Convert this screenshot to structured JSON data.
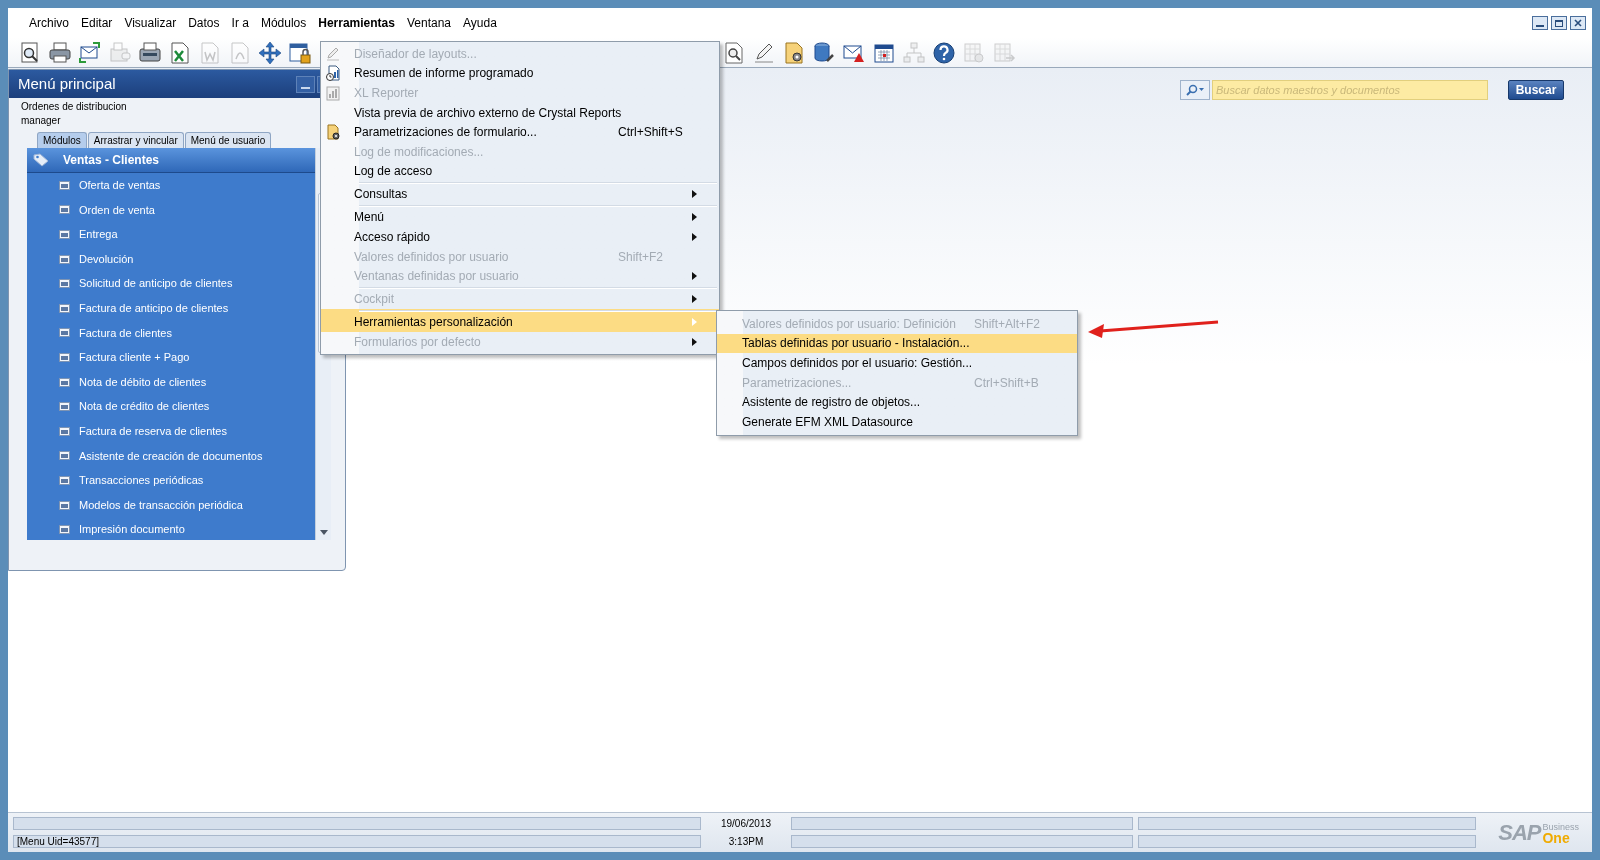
{
  "menubar": [
    {
      "label": "Archivo",
      "selected": false
    },
    {
      "label": "Editar",
      "selected": false
    },
    {
      "label": "Visualizar",
      "selected": false
    },
    {
      "label": "Datos",
      "selected": false
    },
    {
      "label": "Ir a",
      "selected": false
    },
    {
      "label": "Módulos",
      "selected": false
    },
    {
      "label": "Herramientas",
      "selected": true
    },
    {
      "label": "Ventana",
      "selected": false
    },
    {
      "label": "Ayuda",
      "selected": false
    }
  ],
  "toolbar": {
    "left": [
      {
        "disabled": false
      },
      {
        "disabled": false
      },
      {
        "disabled": false
      },
      {
        "disabled": true
      },
      {
        "disabled": false
      },
      {
        "disabled": false
      },
      {
        "disabled": true
      },
      {
        "disabled": true
      },
      {
        "disabled": false
      },
      {
        "disabled": false
      }
    ],
    "right": [
      {
        "disabled": false
      },
      {
        "disabled": false
      },
      {
        "disabled": false
      },
      {
        "disabled": false
      },
      {
        "disabled": false
      },
      {
        "disabled": false
      },
      {
        "disabled": true
      },
      {
        "disabled": false
      },
      {
        "disabled": true
      },
      {
        "disabled": true
      }
    ]
  },
  "search": {
    "placeholder": "Buscar datos maestros y documentos",
    "button": "Buscar"
  },
  "main_menu": {
    "title": "Menú principal",
    "company": "Ordenes de distribucion",
    "user": "manager",
    "tabs": [
      {
        "label": "Módulos",
        "selected": true
      },
      {
        "label": "Arrastrar y vincular",
        "selected": false
      },
      {
        "label": "Menú de usuario",
        "selected": false
      }
    ],
    "module": "Ventas - Clientes",
    "items": [
      "Oferta de ventas",
      "Orden de venta",
      "Entrega",
      "Devolución",
      "Solicitud de anticipo de clientes",
      "Factura de anticipo de clientes",
      "Factura de clientes",
      "Factura cliente + Pago",
      "Nota de débito de clientes",
      "Nota de crédito de clientes",
      "Factura de reserva de clientes",
      "Asistente de creación de documentos",
      "Transacciones periódicas",
      "Modelos de transacción periódica",
      "Impresión documento"
    ]
  },
  "tools_menu": [
    {
      "label": "Diseñador de layouts...",
      "disabled": true,
      "selected": false,
      "submenu": false,
      "separator_before": false
    },
    {
      "label": "Resumen de informe programado",
      "disabled": false,
      "selected": false,
      "submenu": false,
      "separator_before": false
    },
    {
      "label": "XL Reporter",
      "disabled": true,
      "selected": false,
      "submenu": false,
      "separator_before": false
    },
    {
      "label": "Vista previa de archivo externo de Crystal Reports",
      "disabled": false,
      "selected": false,
      "submenu": false,
      "separator_before": false
    },
    {
      "label": "Parametrizaciones de formulario...",
      "shortcut": "Ctrl+Shift+S",
      "disabled": false,
      "selected": false,
      "submenu": false,
      "separator_before": false
    },
    {
      "label": "Log de modificaciones...",
      "disabled": true,
      "selected": false,
      "submenu": false,
      "separator_before": false
    },
    {
      "label": "Log de acceso",
      "disabled": false,
      "selected": false,
      "submenu": false,
      "separator_before": false
    },
    {
      "label": "Consultas",
      "disabled": false,
      "selected": false,
      "submenu": true,
      "separator_before": true
    },
    {
      "label": "Menú",
      "disabled": false,
      "selected": false,
      "submenu": true,
      "separator_before": true
    },
    {
      "label": "Acceso rápido",
      "disabled": false,
      "selected": false,
      "submenu": true,
      "separator_before": false
    },
    {
      "label": "Valores definidos por usuario",
      "shortcut": "Shift+F2",
      "disabled": true,
      "selected": false,
      "submenu": false,
      "separator_before": false
    },
    {
      "label": "Ventanas definidas por usuario",
      "disabled": true,
      "selected": false,
      "submenu": true,
      "separator_before": false
    },
    {
      "label": "Cockpit",
      "disabled": true,
      "selected": false,
      "submenu": true,
      "separator_before": true
    },
    {
      "label": "Herramientas personalización",
      "disabled": false,
      "selected": true,
      "submenu": true,
      "separator_before": true
    },
    {
      "label": "Formularios por defecto",
      "disabled": true,
      "selected": false,
      "submenu": true,
      "separator_before": false
    }
  ],
  "customization_submenu": [
    {
      "label": "Valores definidos por usuario: Definición",
      "shortcut": "Shift+Alt+F2",
      "disabled": true,
      "selected": false
    },
    {
      "label": "Tablas definidas por usuario - Instalación...",
      "disabled": false,
      "selected": true
    },
    {
      "label": "Campos definidos por el usuario: Gestión...",
      "disabled": false,
      "selected": false
    },
    {
      "label": "Parametrizaciones...",
      "shortcut": "Ctrl+Shift+B",
      "disabled": true,
      "selected": false
    },
    {
      "label": "Asistente de registro de objetos...",
      "disabled": false,
      "selected": false
    },
    {
      "label": "Generate EFM XML Datasource",
      "disabled": false,
      "selected": false
    }
  ],
  "status_bar": {
    "message": "[Menu Uid=43577]",
    "date": "19/06/2013",
    "time": "3:13PM",
    "logo": {
      "brand": "SAP",
      "line_1": "Business",
      "line_2": "One"
    }
  }
}
